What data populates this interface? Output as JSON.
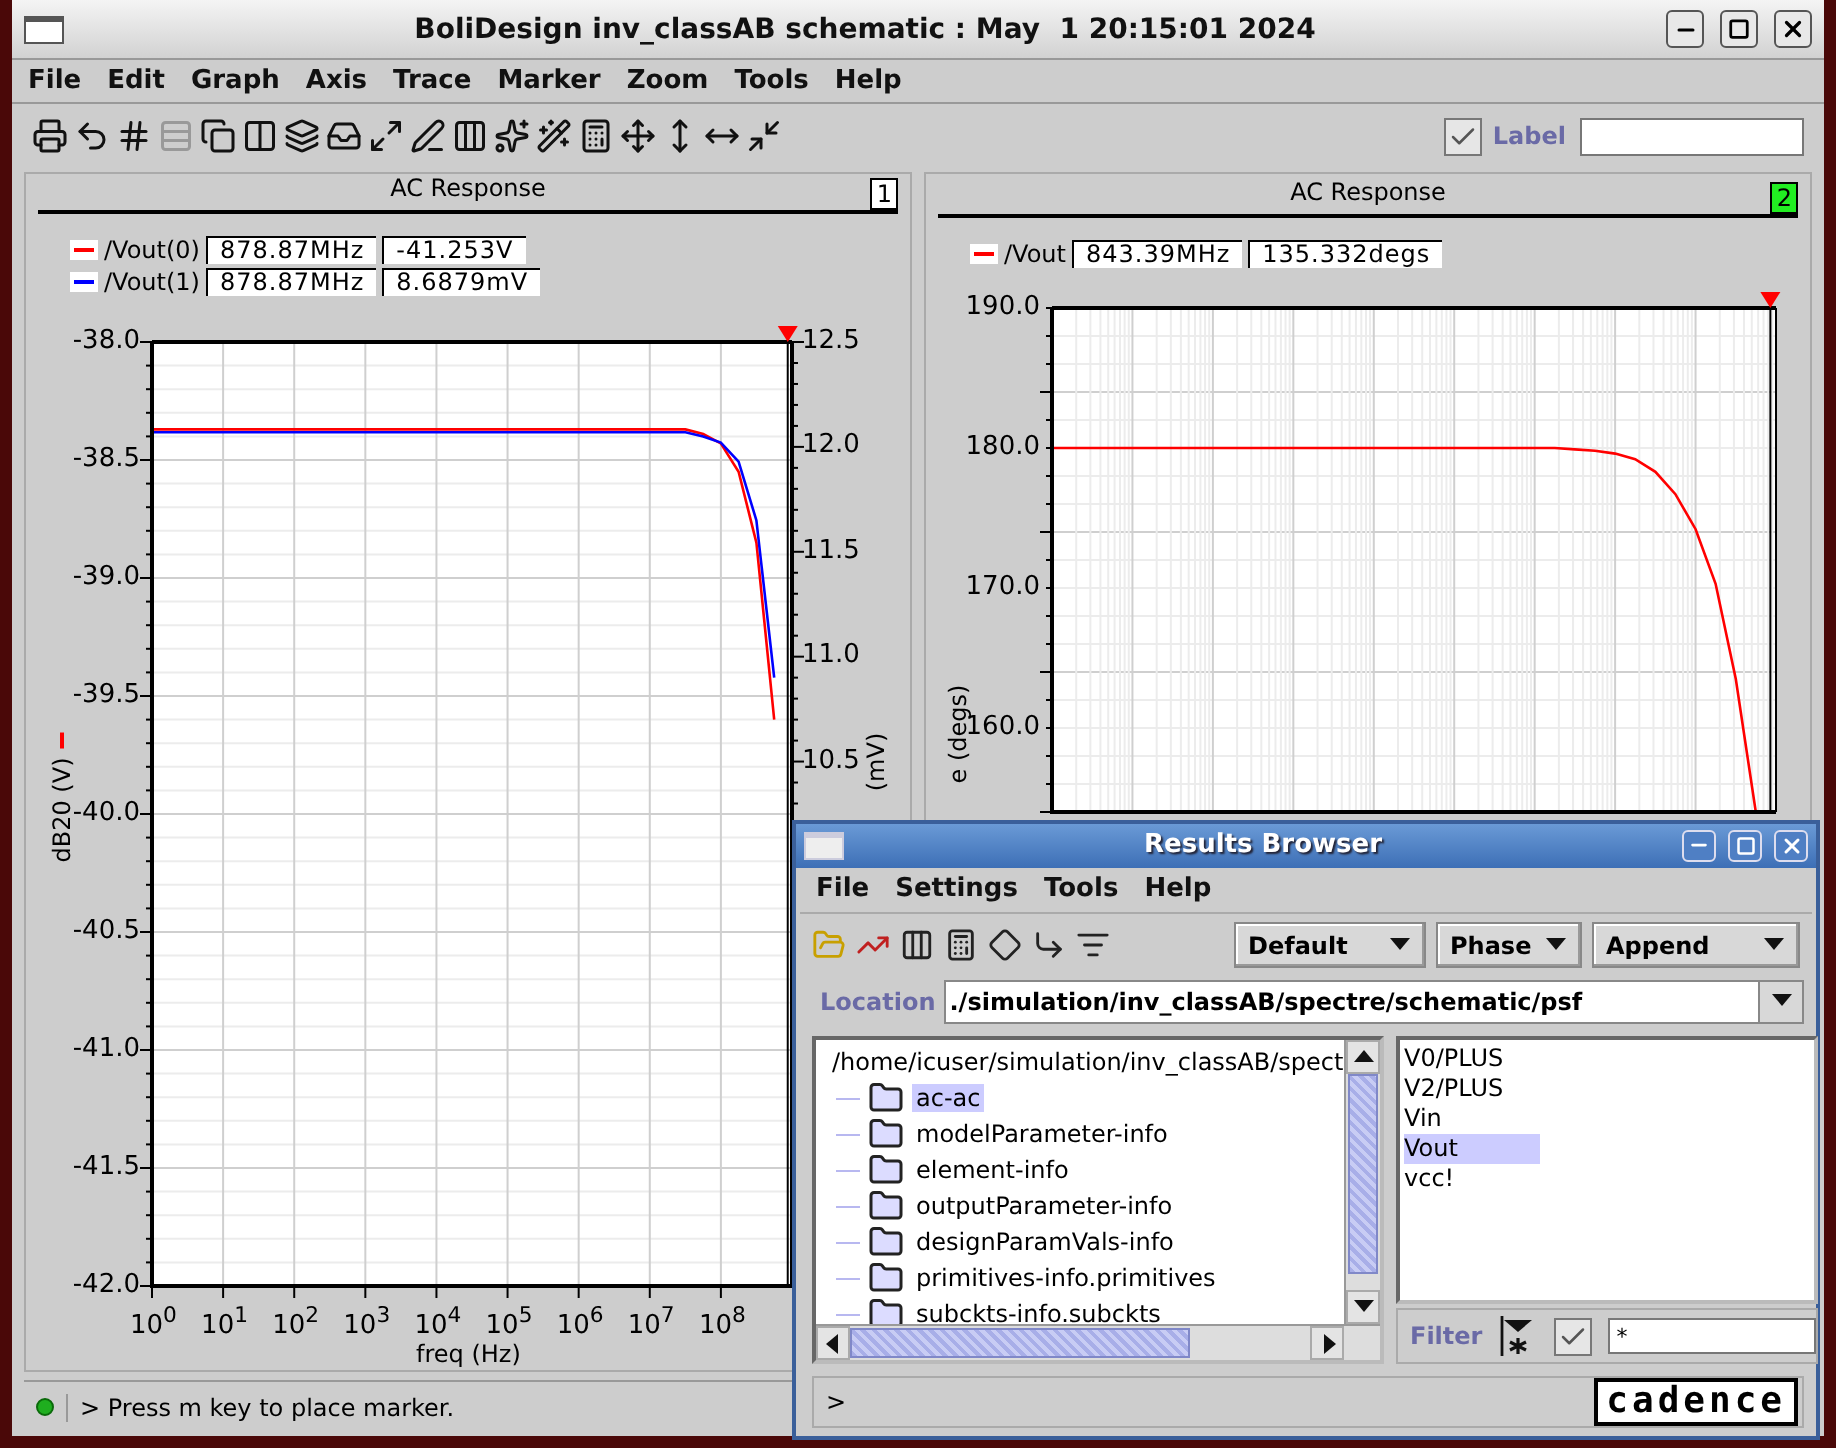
{
  "window": {
    "title": "BoliDesign inv_classAB schematic : May  1 20:15:01 2024"
  },
  "menu": [
    "File",
    "Edit",
    "Graph",
    "Axis",
    "Trace",
    "Marker",
    "Zoom",
    "Tools",
    "Help"
  ],
  "label_toggle": {
    "label": "Label",
    "checked": true
  },
  "panels": [
    {
      "title": "AC Response",
      "number": "1",
      "selected": false,
      "legend": [
        {
          "x_value": "878.87MHz",
          "y_value": "-41.253V"
        },
        {
          "x_value": "878.87MHz",
          "y_value": "8.6879mV"
        }
      ],
      "x_axis_labels": [
        "10$^{0}$",
        "10$^{1}$",
        "10$^{2}$",
        "10$^{3}$",
        "10$^{4}$",
        "10$^{5}$",
        "10$^{6}$",
        "10$^{7}$",
        "10$^{8}$"
      ],
      "chart_data": {
        "type": "line",
        "grid": true,
        "xlabel": "freq (Hz)",
        "ylabel": "dB20 (V)",
        "y2label": "(mV)",
        "ylim": [
          -42,
          -38
        ],
        "y2lim": [
          8,
          12.5
        ],
        "yticks": [
          {
            "value": -38,
            "label": "-38.0"
          },
          {
            "value": -38.5,
            "label": "-38.5"
          },
          {
            "value": -39,
            "label": "-39.0"
          },
          {
            "value": -39.5,
            "label": "-39.5"
          },
          {
            "value": -40,
            "label": "-40.0"
          },
          {
            "value": -40.5,
            "label": "-40.5"
          },
          {
            "value": -41,
            "label": "-41.0"
          },
          {
            "value": -41.5,
            "label": "-41.5"
          },
          {
            "value": -42,
            "label": "-42.0"
          }
        ],
        "y2ticks": [
          {
            "value": 12.5,
            "label": "12.5"
          },
          {
            "value": 12,
            "label": "12.0"
          },
          {
            "value": 11.5,
            "label": "11.5"
          },
          {
            "value": 11,
            "label": "11.0"
          },
          {
            "value": 10.5,
            "label": "10.5"
          }
        ],
        "series": [
          {
            "name": "/Vout(0)",
            "color": "#ff0000",
            "values": [
              -38.37,
              -38.37,
              -38.37,
              -38.37,
              -38.37,
              -38.37,
              -38.37,
              -38.37,
              -38.37,
              -38.37,
              -38.37,
              -38.37,
              -38.37,
              -38.37,
              -38.37,
              -38.37,
              -38.37,
              -38.37,
              -38.37,
              -38.37,
              -38.37,
              -38.37,
              -38.37,
              -38.37,
              -38.37,
              -38.37,
              -38.37,
              -38.37,
              -38.37,
              -38.37,
              -38.37,
              -38.39,
              -38.43,
              -38.55,
              -38.85,
              -39.6,
              null
            ]
          },
          {
            "name": "/Vout(1)",
            "color": "#0000ff",
            "axis": "y2",
            "values": [
              12.07,
              12.07,
              12.07,
              12.07,
              12.07,
              12.07,
              12.07,
              12.07,
              12.07,
              12.07,
              12.07,
              12.07,
              12.07,
              12.07,
              12.07,
              12.07,
              12.07,
              12.07,
              12.07,
              12.07,
              12.07,
              12.07,
              12.07,
              12.07,
              12.07,
              12.07,
              12.07,
              12.07,
              12.07,
              12.07,
              12.07,
              12.05,
              12.02,
              11.93,
              11.65,
              10.9,
              null
            ]
          }
        ]
      }
    },
    {
      "title": "AC Response",
      "number": "2",
      "selected": true,
      "legend": [
        {
          "x_value": "843.39MHz",
          "y_value": "135.332degs"
        }
      ],
      "chart_data": {
        "type": "line",
        "grid": true,
        "ylabel": "e (degs)",
        "ylim": [
          154,
          190
        ],
        "yticks": [
          {
            "value": 190,
            "label": "190.0"
          },
          {
            "value": 180,
            "label": "180.0"
          },
          {
            "value": 170,
            "label": "170.0"
          },
          {
            "value": 160,
            "label": "160.0"
          }
        ],
        "series": [
          {
            "name": "/Vout",
            "color": "#ff0000",
            "values": [
              180,
              180,
              180,
              180,
              180,
              180,
              180,
              180,
              180,
              180,
              180,
              180,
              180,
              180,
              180,
              180,
              180,
              180,
              180,
              180,
              180,
              180,
              180,
              180,
              180,
              180,
              179.9,
              179.8,
              179.6,
              179.2,
              178.3,
              176.7,
              174.2,
              170.3,
              163.5,
              154,
              null
            ]
          }
        ]
      }
    }
  ],
  "status_bar": {
    "message": "> Press m key to place marker."
  },
  "results_browser": {
    "title": "Results Browser",
    "menu": [
      "File",
      "Settings",
      "Tools",
      "Help"
    ],
    "dropdowns": [
      "Default",
      "Phase",
      "Append"
    ],
    "location": {
      "label": "Location",
      "value": "./simulation/inv_classAB/spectre/schematic/psf"
    },
    "tree": {
      "label": "/home/icuser/simulation/inv_classAB/spect",
      "children": [
        {
          "label": "ac-ac",
          "selected": true
        },
        {
          "label": "modelParameter-info",
          "selected": false
        },
        {
          "label": "element-info",
          "selected": false
        },
        {
          "label": "outputParameter-info",
          "selected": false
        },
        {
          "label": "designParamVals-info",
          "selected": false
        },
        {
          "label": "primitives-info.primitives",
          "selected": false
        },
        {
          "label": "subckts-info.subckts",
          "selected": false
        }
      ]
    },
    "signals": [
      {
        "name": "V0/PLUS",
        "selected": false
      },
      {
        "name": "V2/PLUS",
        "selected": false
      },
      {
        "name": "Vin",
        "selected": false
      },
      {
        "name": "Vout",
        "selected": true
      },
      {
        "name": "vcc!",
        "selected": false
      }
    ],
    "filter": {
      "label": "Filter",
      "checked": true,
      "value": "*"
    },
    "prompt": ">",
    "logo": "cadence"
  }
}
